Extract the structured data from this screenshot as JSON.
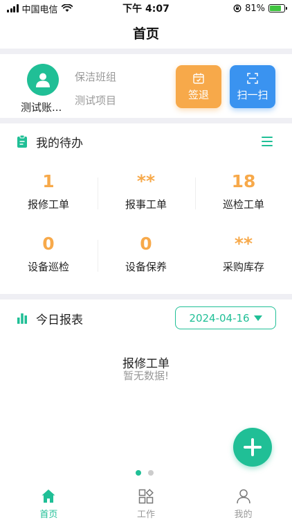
{
  "status_bar": {
    "carrier": "中国电信",
    "time": "下午 4:07",
    "battery": "81%",
    "battery_level": 0.81
  },
  "nav": {
    "title": "首页"
  },
  "profile": {
    "name": "测试账...",
    "team": "保洁班组",
    "project": "测试项目",
    "buttons": {
      "signout": "签退",
      "scan": "扫一扫"
    }
  },
  "todo": {
    "title": "我的待办",
    "items": [
      {
        "value": "1",
        "label": "报修工单"
      },
      {
        "value": "**",
        "label": "报事工单"
      },
      {
        "value": "18",
        "label": "巡检工单"
      },
      {
        "value": "0",
        "label": "设备巡检"
      },
      {
        "value": "0",
        "label": "设备保养"
      },
      {
        "value": "**",
        "label": "采购库存"
      }
    ]
  },
  "report": {
    "title": "今日报表",
    "date": "2024-04-16",
    "chart_title": "报修工单",
    "empty_text": "暂无数据!"
  },
  "tabs": [
    {
      "label": "首页",
      "icon": "home-icon",
      "active": true
    },
    {
      "label": "工作",
      "icon": "grid-icon",
      "active": false
    },
    {
      "label": "我的",
      "icon": "person-icon",
      "active": false
    }
  ],
  "colors": {
    "accent": "#20bf96",
    "orange": "#f7a94a",
    "blue": "#3a93f0"
  }
}
